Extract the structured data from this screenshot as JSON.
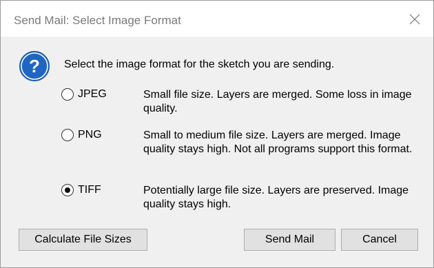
{
  "window": {
    "title": "Send Mail: Select Image Format"
  },
  "dialog": {
    "icon": "question-icon",
    "instruction": "Select the image format for the sketch you are sending.",
    "options": [
      {
        "label": "JPEG",
        "selected": false,
        "description": "Small file size. Layers are merged. Some loss in image quality."
      },
      {
        "label": "PNG",
        "selected": false,
        "description": "Small to medium file size. Layers are merged. Image quality stays high. Not all programs support this format."
      },
      {
        "label": "TIFF",
        "selected": true,
        "description": "Potentially large file size. Layers are preserved. Image quality stays high."
      }
    ]
  },
  "buttons": {
    "calculate": "Calculate File Sizes",
    "send": "Send Mail",
    "cancel": "Cancel"
  },
  "colors": {
    "icon_blue": "#1f66c2",
    "dialog_background": "#f0f0f0",
    "button_background": "#e1e1e1"
  }
}
